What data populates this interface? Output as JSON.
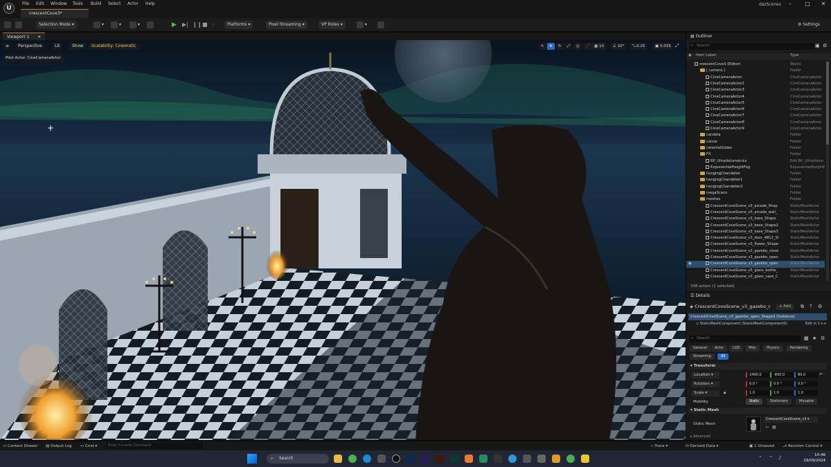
{
  "titlebar": {
    "menus": [
      "File",
      "Edit",
      "Window",
      "Tools",
      "Build",
      "Select",
      "Actor",
      "Help"
    ],
    "doc_tab": "crescentCove3*",
    "app_name": "dazScenes"
  },
  "toolbar": {
    "selection_mode": "Selection Mode",
    "platforms": "Platforms",
    "pixel_streaming": "Pixel Streaming",
    "vp_roles": "VP Roles",
    "settings": "Settings"
  },
  "viewport": {
    "tab_label": "Viewport 1",
    "perspective": "Perspective",
    "lit": "Lit",
    "show": "Show",
    "scalability": "Scalability: Cinematic",
    "pilot": "Pilot Actor: CineCameraActor",
    "grid_size": "10",
    "rot_snap": "10°",
    "scale_snap": "0.25",
    "cam_speed": "0.033"
  },
  "outliner": {
    "title": "Outliner",
    "search_placeholder": "Search",
    "col_label": "Item Label",
    "col_type": "Type",
    "rows": [
      {
        "label": "crescentCove3 (Editor)",
        "type": "World",
        "indent": 1,
        "kind": "world"
      },
      {
        "label": "[ camera ]",
        "type": "Folder",
        "indent": 2,
        "kind": "folder"
      },
      {
        "label": "CineCameraActor",
        "type": "CineCameraActor",
        "indent": 3,
        "kind": "actor"
      },
      {
        "label": "CineCameraActor2",
        "type": "CineCameraActor",
        "indent": 3,
        "kind": "actor"
      },
      {
        "label": "CineCameraActor3",
        "type": "CineCameraActor",
        "indent": 3,
        "kind": "actor"
      },
      {
        "label": "CineCameraActor4",
        "type": "CineCameraActor",
        "indent": 3,
        "kind": "actor"
      },
      {
        "label": "CineCameraActor5",
        "type": "CineCameraActor",
        "indent": 3,
        "kind": "actor"
      },
      {
        "label": "CineCameraActor6",
        "type": "CineCameraActor",
        "indent": 3,
        "kind": "actor"
      },
      {
        "label": "CineCameraActor7",
        "type": "CineCameraActor",
        "indent": 3,
        "kind": "actor"
      },
      {
        "label": "CineCameraActor8",
        "type": "CineCameraActor",
        "indent": 3,
        "kind": "actor"
      },
      {
        "label": "CineCameraActor9",
        "type": "CineCameraActor",
        "indent": 3,
        "kind": "actor"
      },
      {
        "label": "candela",
        "type": "Folder",
        "indent": 2,
        "kind": "folder"
      },
      {
        "label": "canoe",
        "type": "Folder",
        "indent": 2,
        "kind": "folder"
      },
      {
        "label": "celestialGlobe",
        "type": "Folder",
        "indent": 2,
        "kind": "folder"
      },
      {
        "label": "FX",
        "type": "Folder",
        "indent": 2,
        "kind": "folder"
      },
      {
        "label": "BP_UltraVolumetrics",
        "type": "Edit BP_UltraVolun",
        "indent": 3,
        "kind": "actor"
      },
      {
        "label": "ExponentialHeightFog",
        "type": "ExponentialHeightF",
        "indent": 3,
        "kind": "actor"
      },
      {
        "label": "hangingChandelier",
        "type": "Folder",
        "indent": 2,
        "kind": "folder"
      },
      {
        "label": "hangingChandelier1",
        "type": "Folder",
        "indent": 2,
        "kind": "folder"
      },
      {
        "label": "hangingChandelier2",
        "type": "Folder",
        "indent": 2,
        "kind": "folder"
      },
      {
        "label": "megaScans",
        "type": "Folder",
        "indent": 2,
        "kind": "folder"
      },
      {
        "label": "meshes",
        "type": "Folder",
        "indent": 2,
        "kind": "folder"
      },
      {
        "label": "CrescentCoveScene_v3_arcade_Shap",
        "type": "StaticMeshActor",
        "indent": 3,
        "kind": "actor"
      },
      {
        "label": "CrescentCoveScene_v3_arcade_wall_",
        "type": "StaticMeshActor",
        "indent": 3,
        "kind": "actor"
      },
      {
        "label": "CrescentCoveScene_v3_base_Shape",
        "type": "StaticMeshActor",
        "indent": 3,
        "kind": "actor"
      },
      {
        "label": "CrescentCoveScene_v3_base_Shape2",
        "type": "StaticMeshActor",
        "indent": 3,
        "kind": "actor"
      },
      {
        "label": "CrescentCoveScene_v3_base_Shape3",
        "type": "StaticMeshActor",
        "indent": 3,
        "kind": "actor"
      },
      {
        "label": "CrescentCoveScene_v3_door_4812_Sl",
        "type": "StaticMeshActor",
        "indent": 3,
        "kind": "actor"
      },
      {
        "label": "CrescentCoveScene_v3_flower_Shape",
        "type": "StaticMeshActor",
        "indent": 3,
        "kind": "actor"
      },
      {
        "label": "CrescentCoveScene_v3_gazebo_close",
        "type": "StaticMeshActor",
        "indent": 3,
        "kind": "actor"
      },
      {
        "label": "CrescentCoveScene_v3_gazebo_open",
        "type": "StaticMeshActor",
        "indent": 3,
        "kind": "actor"
      },
      {
        "label": "CrescentCoveScene_v3_gazebo_open",
        "type": "StaticMeshActor",
        "indent": 3,
        "kind": "actor",
        "selected": true
      },
      {
        "label": "CrescentCoveScene_v3_glass_bottle_",
        "type": "StaticMeshActor",
        "indent": 3,
        "kind": "actor"
      },
      {
        "label": "CrescentCoveScene_v3_glass_vase_C",
        "type": "StaticMeshActor",
        "indent": 3,
        "kind": "actor"
      }
    ],
    "footer": "336 actors (1 selected)"
  },
  "details": {
    "title": "Details",
    "object_name": "CrescentCoveScene_v3_gazebo_c",
    "add_label": "+ Add",
    "instance": "CrescentCoveScene_v3_gazebo_open_Shape2 (Instance)",
    "component": "StaticMeshComponent (StaticMeshComponent0)",
    "edit_cpp": "Edit in C++",
    "search_placeholder": "Search",
    "tabs": [
      "General",
      "Actor",
      "LOD",
      "Misc",
      "Physics",
      "Rendering",
      "Streaming",
      "All"
    ],
    "transform_title": "Transform",
    "location_label": "Location",
    "rotation_label": "Rotation",
    "scale_label": "Scale",
    "mobility_label": "Mobility",
    "location": [
      "1400.0",
      "-800.0",
      "80.0"
    ],
    "rotation": [
      "0.0 °",
      "0.0 °",
      "0.0 °"
    ],
    "scale": [
      "1.0",
      "1.0",
      "1.0"
    ],
    "mobility": [
      "Static",
      "Stationary",
      "Movable"
    ],
    "static_mesh_title": "Static Mesh",
    "static_mesh_label": "Static Mesh",
    "static_mesh_value": "CrescentCoveScene_v3",
    "advanced": "Advanced"
  },
  "statusbar": {
    "content_drawer": "Content Drawer",
    "output_log": "Output Log",
    "cmd": "Cmd",
    "cmd_placeholder": "Enter Console Command",
    "trace": "Trace",
    "derived_data": "Derived Data",
    "unsaved": "1 Unsaved",
    "revision_control": "Revision Control"
  },
  "taskbar": {
    "search": "Search",
    "time": "14:46",
    "date": "29/09/2024"
  }
}
